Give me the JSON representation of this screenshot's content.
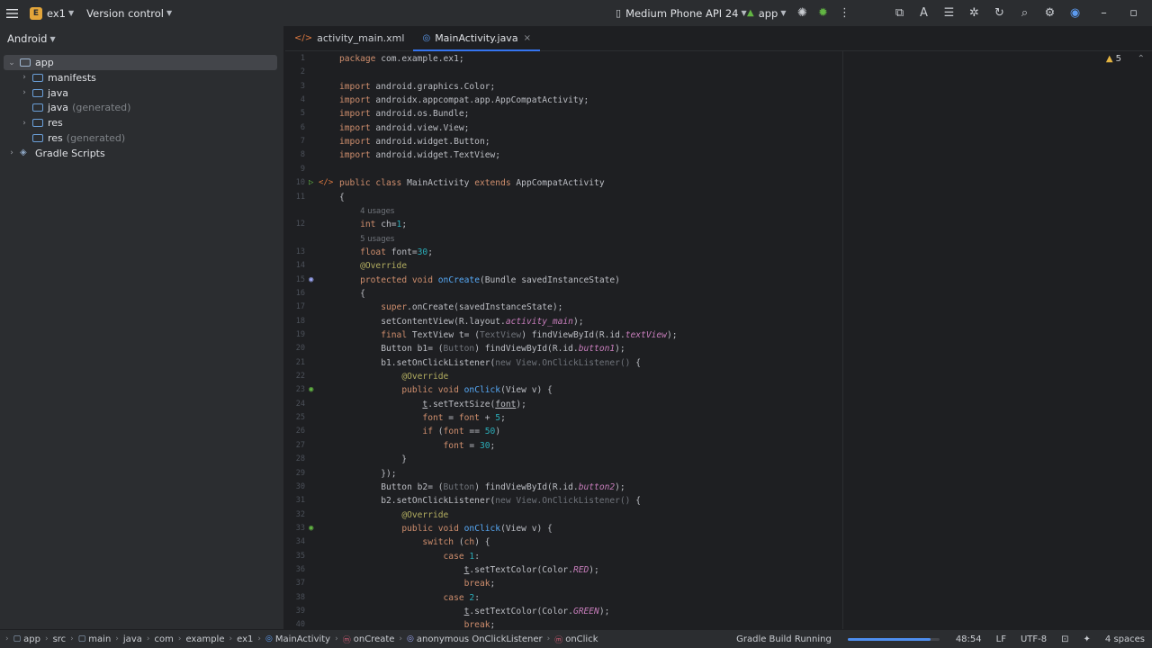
{
  "titlebar": {
    "project_letter": "E",
    "project_name": "ex1",
    "version_control": "Version control",
    "device": "Medium Phone API 24",
    "run_config": "app"
  },
  "project_panel": {
    "view_mode": "Android",
    "tree": [
      {
        "label": "app",
        "extra": "",
        "level": 0,
        "expanded": true,
        "selected": true,
        "has_arrow": true
      },
      {
        "label": "manifests",
        "extra": "",
        "level": 1,
        "expanded": false,
        "selected": false,
        "has_arrow": true
      },
      {
        "label": "java",
        "extra": "",
        "level": 1,
        "expanded": false,
        "selected": false,
        "has_arrow": true
      },
      {
        "label": "java",
        "extra": "(generated)",
        "level": 1,
        "expanded": false,
        "selected": false,
        "has_arrow": false
      },
      {
        "label": "res",
        "extra": "",
        "level": 1,
        "expanded": false,
        "selected": false,
        "has_arrow": true
      },
      {
        "label": "res",
        "extra": "(generated)",
        "level": 1,
        "expanded": false,
        "selected": false,
        "has_arrow": false
      },
      {
        "label": "Gradle Scripts",
        "extra": "",
        "level": 0,
        "expanded": false,
        "selected": false,
        "has_arrow": true
      }
    ]
  },
  "editor": {
    "tabs": [
      {
        "label": "activity_main.xml",
        "type": "xml",
        "active": false
      },
      {
        "label": "MainActivity.java",
        "type": "java",
        "active": true
      }
    ],
    "close_glyph": "×",
    "warnings_count": "5",
    "lines": [
      {
        "n": "1",
        "code": "<span class='k'>package</span> com.example.ex1;"
      },
      {
        "n": "2",
        "code": ""
      },
      {
        "n": "3",
        "code": "<span class='k'>import</span> android.graphics.Color;"
      },
      {
        "n": "4",
        "code": "<span class='k'>import</span> androidx.appcompat.app.AppCompatActivity;"
      },
      {
        "n": "5",
        "code": "<span class='k'>import</span> android.os.Bundle;"
      },
      {
        "n": "6",
        "code": "<span class='k'>import</span> android.view.View;"
      },
      {
        "n": "7",
        "code": "<span class='k'>import</span> android.widget.Button;"
      },
      {
        "n": "8",
        "code": "<span class='k'>import</span> android.widget.TextView;"
      },
      {
        "n": "9",
        "code": ""
      },
      {
        "n": "10",
        "code": "<span class='k'>public class</span> MainActivity <span class='k'>extends</span> AppCompatActivity",
        "gutter": "run"
      },
      {
        "n": "11",
        "code": "{"
      },
      {
        "n": "",
        "code": "    <span class='hint'>4 usages</span>",
        "hint": true
      },
      {
        "n": "12",
        "code": "    <span class='k'>int</span> ch=<span class='n'>1</span>;"
      },
      {
        "n": "",
        "code": "    <span class='hint'>5 usages</span>",
        "hint": true
      },
      {
        "n": "13",
        "code": "    <span class='k'>float</span> font=<span class='n'>30</span>;"
      },
      {
        "n": "14",
        "code": "    <span class='a'>@Override</span>"
      },
      {
        "n": "15",
        "code": "    <span class='k'>protected void</span> <span class='f'>onCreate</span>(Bundle savedInstanceState)",
        "gutter": "override"
      },
      {
        "n": "16",
        "code": "    {"
      },
      {
        "n": "17",
        "code": "        <span class='k'>super</span>.onCreate(savedInstanceState);"
      },
      {
        "n": "18",
        "code": "        setContentView(R.layout.<span class='it'>activity_main</span>);"
      },
      {
        "n": "19",
        "code": "        <span class='k'>final</span> TextView t= (<span class='dim'>TextView</span>) findViewById(R.id.<span class='it'>textView</span>);"
      },
      {
        "n": "20",
        "code": "        Button b1= (<span class='dim'>Button</span>) findViewById(R.id.<span class='it'>button1</span>);"
      },
      {
        "n": "21",
        "code": "        b1.setOnClickListener(<span class='dim'>new View.OnClickListener() </span>{"
      },
      {
        "n": "22",
        "code": "            <span class='a'>@Override</span>"
      },
      {
        "n": "23",
        "code": "            <span class='k'>public void</span> <span class='f'>onClick</span>(View v) {",
        "gutter": "impl"
      },
      {
        "n": "24",
        "code": "                <span class='ul'>t</span>.setTextSize(<span class='ul'>font</span>);"
      },
      {
        "n": "25",
        "code": "                <span class='k'>font</span> = <span class='k'>font</span> + <span class='n'>5</span>;"
      },
      {
        "n": "26",
        "code": "                <span class='k'>if</span> (<span class='k'>font</span> == <span class='n'>50</span>)"
      },
      {
        "n": "27",
        "code": "                    <span class='k'>font</span> = <span class='n'>30</span>;"
      },
      {
        "n": "28",
        "code": "            }"
      },
      {
        "n": "29",
        "code": "        });"
      },
      {
        "n": "30",
        "code": "        Button b2= (<span class='dim'>Button</span>) findViewById(R.id.<span class='it'>button2</span>);"
      },
      {
        "n": "31",
        "code": "        b2.setOnClickListener(<span class='dim'>new View.OnClickListener() </span>{"
      },
      {
        "n": "32",
        "code": "            <span class='a'>@Override</span>"
      },
      {
        "n": "33",
        "code": "            <span class='k'>public void</span> <span class='f'>onClick</span>(View v) {",
        "gutter": "impl"
      },
      {
        "n": "34",
        "code": "                <span class='k'>switch</span> (<span class='k'>ch</span>) {"
      },
      {
        "n": "35",
        "code": "                    <span class='k'>case</span> <span class='n'>1</span>:"
      },
      {
        "n": "36",
        "code": "                        <span class='ul'>t</span>.setTextColor(Color.<span class='cn'>RED</span>);"
      },
      {
        "n": "37",
        "code": "                        <span class='k'>break</span>;"
      },
      {
        "n": "38",
        "code": "                    <span class='k'>case</span> <span class='n'>2</span>:"
      },
      {
        "n": "39",
        "code": "                        <span class='ul'>t</span>.setTextColor(Color.<span class='cn'>GREEN</span>);"
      },
      {
        "n": "40",
        "code": "                        <span class='k'>break</span>;"
      }
    ]
  },
  "statusbar": {
    "breadcrumbs": [
      {
        "label": "app",
        "icon": "module"
      },
      {
        "label": "src",
        "icon": ""
      },
      {
        "label": "main",
        "icon": "module"
      },
      {
        "label": "java",
        "icon": ""
      },
      {
        "label": "com",
        "icon": ""
      },
      {
        "label": "example",
        "icon": ""
      },
      {
        "label": "ex1",
        "icon": ""
      },
      {
        "label": "MainActivity",
        "icon": "class"
      },
      {
        "label": "onCreate",
        "icon": "method"
      },
      {
        "label": "anonymous OnClickListener",
        "icon": "anon"
      },
      {
        "label": "onClick",
        "icon": "method"
      }
    ],
    "build_status": "Gradle Build Running",
    "build_progress": 0.9,
    "caret": "48:54",
    "line_sep": "LF",
    "encoding": "UTF-8",
    "indent": "4 spaces"
  },
  "colors": {
    "accent": "#3574f0",
    "project_badge": "#e3a53a"
  }
}
